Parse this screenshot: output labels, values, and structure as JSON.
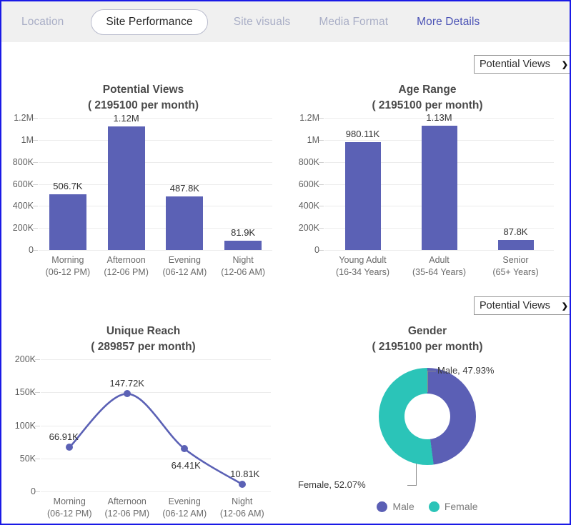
{
  "tabs": [
    {
      "label": "Location",
      "state": "muted"
    },
    {
      "label": "Site Performance",
      "state": "active"
    },
    {
      "label": "Site visuals",
      "state": "muted"
    },
    {
      "label": "Media Format",
      "state": "muted"
    },
    {
      "label": "More Details",
      "state": "link"
    }
  ],
  "dropdowns": [
    {
      "value": "Potential Views",
      "caret": "chevron-down-icon"
    },
    {
      "value": "Potential Views",
      "caret": "chevron-down-icon"
    }
  ],
  "colors": {
    "bar": "#5b61b5",
    "line": "#5b61b5",
    "male": "#5b5fb5",
    "female": "#2bc4b8",
    "tab_link": "#4a52b5",
    "tab_muted": "#a9aec6",
    "frame": "#1a1ae6",
    "tabbar_bg": "#f0f0f0"
  },
  "chart_data": [
    {
      "type": "bar",
      "title": "Potential Views",
      "subtitle": "( 2195100 per month)",
      "xlabel": "",
      "ylabel": "",
      "grid": true,
      "ylim": [
        0,
        1200000
      ],
      "yticks": [
        "0",
        "200K",
        "400K",
        "600K",
        "800K",
        "1M",
        "1.2M"
      ],
      "ytick_values": [
        0,
        200000,
        400000,
        600000,
        800000,
        1000000,
        1200000
      ],
      "categories": [
        "Morning",
        "Afternoon",
        "Evening",
        "Night"
      ],
      "category_sublabels": [
        "(06-12 PM)",
        "(12-06 PM)",
        "(06-12 AM)",
        "(12-06 AM)"
      ],
      "values": [
        506700,
        1120000,
        487800,
        81900
      ],
      "value_labels": [
        "506.7K",
        "1.12M",
        "487.8K",
        "81.9K"
      ]
    },
    {
      "type": "bar",
      "title": "Age Range",
      "subtitle": "( 2195100 per month)",
      "xlabel": "",
      "ylabel": "",
      "grid": true,
      "ylim": [
        0,
        1200000
      ],
      "yticks": [
        "0",
        "200K",
        "400K",
        "600K",
        "800K",
        "1M",
        "1.2M"
      ],
      "ytick_values": [
        0,
        200000,
        400000,
        600000,
        800000,
        1000000,
        1200000
      ],
      "categories": [
        "Young Adult",
        "Adult",
        "Senior"
      ],
      "category_sublabels": [
        "(16-34 Years)",
        "(35-64 Years)",
        "(65+ Years)"
      ],
      "values": [
        980110,
        1130000,
        87800
      ],
      "value_labels": [
        "980.11K",
        "1.13M",
        "87.8K"
      ]
    },
    {
      "type": "line",
      "title": "Unique Reach",
      "subtitle": "( 289857 per month)",
      "xlabel": "",
      "ylabel": "",
      "grid": true,
      "ylim": [
        0,
        200000
      ],
      "yticks": [
        "0",
        "50K",
        "100K",
        "150K",
        "200K"
      ],
      "ytick_values": [
        0,
        50000,
        100000,
        150000,
        200000
      ],
      "categories": [
        "Morning",
        "Afternoon",
        "Evening",
        "Night"
      ],
      "category_sublabels": [
        "(06-12 PM)",
        "(12-06 PM)",
        "(06-12 AM)",
        "(12-06 AM)"
      ],
      "values": [
        66910,
        147720,
        64410,
        10810
      ],
      "value_labels": [
        "66.91K",
        "147.72K",
        "64.41K",
        "10.81K"
      ]
    },
    {
      "type": "pie",
      "title": "Gender",
      "subtitle": "( 2195100 per month)",
      "legend_position": "bottom",
      "labels": [
        "Male",
        "Female"
      ],
      "values": [
        47.93,
        52.07
      ],
      "slice_labels": [
        "Male, 47.93%",
        "Female, 52.07%"
      ],
      "slice_colors": [
        "#5b5fb5",
        "#2bc4b8"
      ]
    }
  ]
}
